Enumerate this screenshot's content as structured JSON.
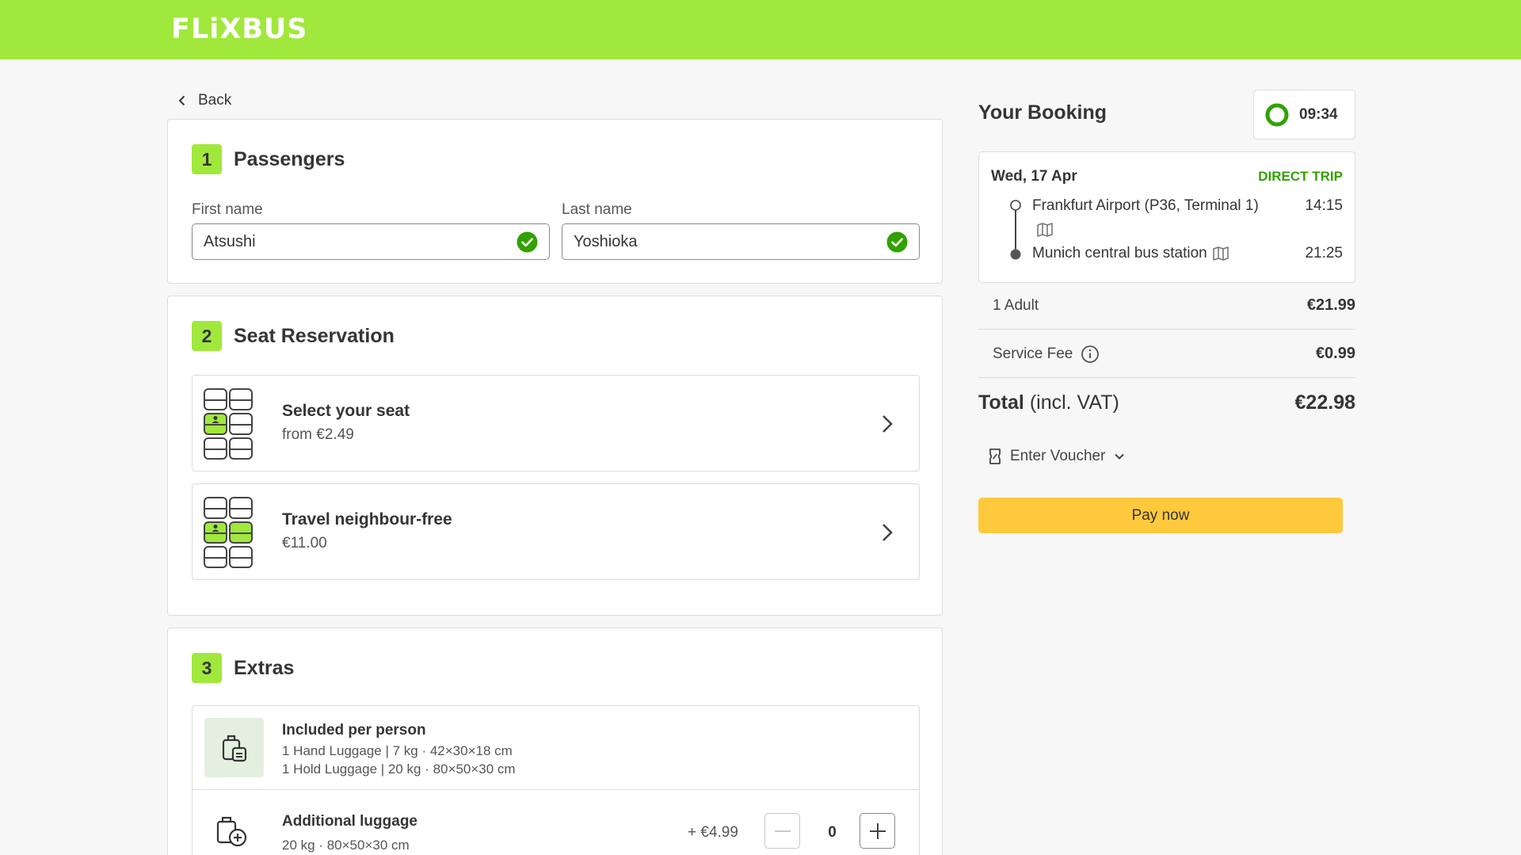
{
  "brand": {
    "logo_text": "FLiXBUS",
    "accent_color": "#a1e83d",
    "pay_color": "#ffc93d",
    "success_color": "#31a100"
  },
  "nav": {
    "back_label": "Back"
  },
  "passengers": {
    "step": "1",
    "title": "Passengers",
    "first_name_label": "First name",
    "first_name_value": "Atsushi",
    "last_name_label": "Last name",
    "last_name_value": "Yoshioka"
  },
  "seats": {
    "step": "2",
    "title": "Seat Reservation",
    "options": [
      {
        "title": "Select your seat",
        "price": "from €2.49"
      },
      {
        "title": "Travel neighbour-free",
        "price": "€11.00"
      }
    ]
  },
  "extras": {
    "step": "3",
    "title": "Extras",
    "included_title": "Included per person",
    "included_lines": [
      "1 Hand Luggage | 7 kg · 42×30×18 cm",
      "1 Hold Luggage | 20 kg · 80×50×30 cm"
    ],
    "additional_title": "Additional luggage",
    "additional_sub": "20 kg · 80×50×30 cm",
    "additional_price": "+ €4.99",
    "additional_qty": "0"
  },
  "booking": {
    "title": "Your Booking",
    "timer": "09:34",
    "date": "Wed, 17 Apr",
    "trip_type": "DIRECT TRIP",
    "departure_stop": "Frankfurt Airport (P36, Terminal 1)",
    "departure_time": "14:15",
    "arrival_stop": "Munich central bus station",
    "arrival_time": "21:25",
    "adult_label": "1 Adult",
    "adult_price": "€21.99",
    "fee_label": "Service Fee",
    "fee_price": "€0.99",
    "total_label": "Total",
    "total_suffix": "(incl. VAT)",
    "total_price": "€22.98",
    "voucher_label": "Enter Voucher",
    "pay_label": "Pay now"
  }
}
